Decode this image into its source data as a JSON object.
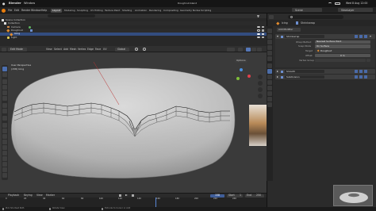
{
  "menubar": {
    "app_name": "Blender",
    "window_menu": "Window",
    "document_title": "Doughnut.blend",
    "clock": "Wed 8 Aug  12:00"
  },
  "topbar": {
    "menus": [
      "File",
      "Edit",
      "Render",
      "Window",
      "Help"
    ],
    "workspace_tabs": [
      "Layout",
      "Modeling",
      "Sculpting",
      "UV Editing",
      "Texture Paint",
      "Shading",
      "Animation",
      "Rendering",
      "Compositing",
      "Geometry Nodes",
      "Scripting"
    ],
    "active_tab": "Layout",
    "scene_label": "Scene",
    "view_layer_label": "ViewLayer"
  },
  "outliner": {
    "rows": [
      {
        "label": "Scene Collection"
      },
      {
        "label": "Collection"
      },
      {
        "label": "Camera"
      },
      {
        "label": "Doughnut"
      },
      {
        "label": "Icing"
      },
      {
        "label": "Light"
      }
    ]
  },
  "viewport_header": {
    "mode": "Edit Mode",
    "menus": [
      "View",
      "Select",
      "Add",
      "Mesh",
      "Vertex",
      "Edge",
      "Face",
      "UV"
    ],
    "transform": "Global",
    "options": "Options"
  },
  "viewport": {
    "view_name": "User Perspective",
    "object_info": "(158) Icing"
  },
  "properties": {
    "object_name": "Icing",
    "modifier_path": "Shrinkwrap",
    "add_modifier": "Add Modifier",
    "shrinkwrap": {
      "name": "Shrinkwrap",
      "wrap_method_label": "Wrap Method",
      "wrap_method": "Nearest Surface Point",
      "snap_mode_label": "Snap Mode",
      "snap_mode": "On Surface",
      "target_label": "Target",
      "target": "Doughnut",
      "offset_label": "Offset",
      "offset": "0 m",
      "vertex_group_label": "Vertex Group"
    },
    "other_modifiers": [
      "Smooth",
      "Subdivision"
    ]
  },
  "timeline": {
    "menus": [
      "Playback",
      "Keying",
      "View",
      "Marker"
    ],
    "current_frame": "158",
    "start_label": "Start",
    "start": "1",
    "end_label": "End",
    "end": "250",
    "ticks": [
      "0",
      "20",
      "40",
      "60",
      "80",
      "100",
      "120",
      "140",
      "160",
      "180",
      "200",
      "220",
      "240"
    ]
  },
  "statusbar": {
    "left": "Pick Shortest Path",
    "middle": "Rotate View",
    "right": "Extrude to Cursor or Add"
  },
  "colors": {
    "accent_selected": "#334d80",
    "active_tab": "#4a4a4a",
    "x_axis": "#e0414c",
    "y_axis": "#7fbf3a",
    "z_axis": "#4a8fe0"
  }
}
